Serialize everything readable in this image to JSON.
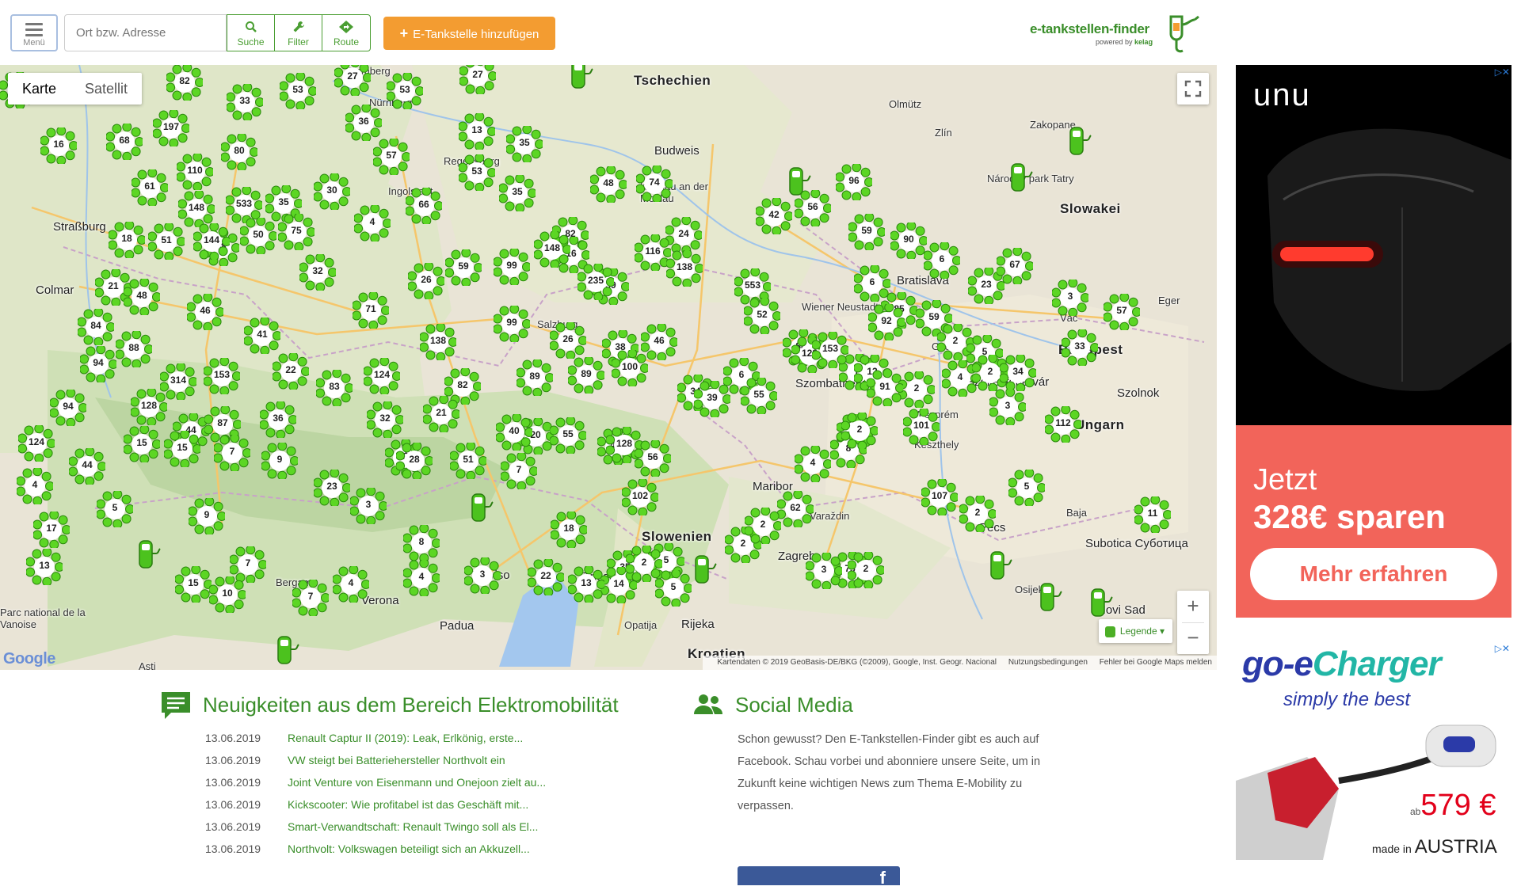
{
  "header": {
    "menu_label": "Menü",
    "search_placeholder": "Ort bzw. Adresse",
    "tools": [
      {
        "label": "Suche",
        "icon": "search-icon"
      },
      {
        "label": "Filter",
        "icon": "wrench-icon"
      },
      {
        "label": "Route",
        "icon": "route-icon"
      }
    ],
    "add_button": "E-Tankstelle hinzufügen",
    "logo_title": "e-tankstellen-finder",
    "logo_powered": "powered by",
    "logo_brand": "kelag"
  },
  "map": {
    "type_options": [
      "Karte",
      "Satellit"
    ],
    "selected_type": "Karte",
    "legend_label": "Legende",
    "attribution": "Kartendaten © 2019 GeoBasis-DE/BKG (©2009), Google, Inst. Geogr. Nacional",
    "terms": "Nutzungsbedingungen",
    "report": "Fehler bei Google Maps melden",
    "google_label": "Google",
    "place_labels": [
      {
        "t": "Tschechien",
        "c": "big"
      },
      {
        "t": "Budweis",
        "c": "mid"
      },
      {
        "t": "Krumau an der Moldau",
        "c": ""
      },
      {
        "t": "Olmütz",
        "c": ""
      },
      {
        "t": "Zlín",
        "c": ""
      },
      {
        "t": "Zakopane",
        "c": ""
      },
      {
        "t": "Národný park Tatry",
        "c": ""
      },
      {
        "t": "Slowakei",
        "c": "big"
      },
      {
        "t": "Bratislava",
        "c": "mid"
      },
      {
        "t": "Straßburg",
        "c": "mid"
      },
      {
        "t": "Colmar",
        "c": "mid"
      },
      {
        "t": "Ingolstadt",
        "c": ""
      },
      {
        "t": "Ungarn",
        "c": "big"
      },
      {
        "t": "Győr",
        "c": ""
      },
      {
        "t": "Székesfehérvár",
        "c": "mid"
      },
      {
        "t": "Veszprém",
        "c": ""
      },
      {
        "t": "Szolnok",
        "c": "mid"
      },
      {
        "t": "Eger",
        "c": ""
      },
      {
        "t": "Vác",
        "c": ""
      },
      {
        "t": "Budapest",
        "c": "big"
      },
      {
        "t": "Szombathely",
        "c": "mid"
      },
      {
        "t": "Maribor",
        "c": "mid"
      },
      {
        "t": "Varaždin",
        "c": ""
      },
      {
        "t": "Zagreb",
        "c": "mid"
      },
      {
        "t": "Slowenien",
        "c": "big"
      },
      {
        "t": "Pécs",
        "c": "mid"
      },
      {
        "t": "Baja",
        "c": ""
      },
      {
        "t": "Subotica Суботица",
        "c": "mid"
      },
      {
        "t": "Osijek",
        "c": ""
      },
      {
        "t": "Novi Sad",
        "c": "mid"
      },
      {
        "t": "Treviso",
        "c": "mid"
      },
      {
        "t": "Verona",
        "c": "mid"
      },
      {
        "t": "Padua",
        "c": "mid"
      },
      {
        "t": "Triest",
        "c": "mid"
      },
      {
        "t": "Rijeka",
        "c": "mid"
      },
      {
        "t": "Opatija",
        "c": ""
      },
      {
        "t": "Kroatien",
        "c": "big"
      },
      {
        "t": "Bergamo",
        "c": ""
      },
      {
        "t": "Parc national de la Vanoise",
        "c": ""
      },
      {
        "t": "Asti",
        "c": ""
      },
      {
        "t": "Salzburg",
        "c": ""
      },
      {
        "t": "Wiener Neustadt",
        "c": ""
      },
      {
        "t": "Keszthely",
        "c": ""
      },
      {
        "t": "Nürnberg",
        "c": ""
      },
      {
        "t": "Regensburg",
        "c": ""
      },
      {
        "t": "Bamberg",
        "c": ""
      }
    ],
    "clusters": [
      "24",
      "16",
      "68",
      "197",
      "82",
      "33",
      "53",
      "27",
      "53",
      "27",
      "13",
      "35",
      "80",
      "110",
      "61",
      "148",
      "533",
      "35",
      "30",
      "57",
      "36",
      "18",
      "51",
      "68",
      "50",
      "75",
      "4",
      "66",
      "53",
      "35",
      "82",
      "16",
      "48",
      "74",
      "39",
      "24",
      "42",
      "56",
      "96",
      "59",
      "90",
      "85",
      "59",
      "2",
      "5",
      "4",
      "2",
      "3",
      "33",
      "57",
      "21",
      "48",
      "144",
      "32",
      "26",
      "59",
      "99",
      "148",
      "235",
      "116",
      "138",
      "553",
      "52",
      "6",
      "6",
      "23",
      "67",
      "84",
      "46",
      "41",
      "71",
      "138",
      "99",
      "26",
      "38",
      "46",
      "88",
      "7",
      "128",
      "12",
      "2",
      "34",
      "112",
      "88",
      "94",
      "153",
      "314",
      "22",
      "124",
      "82",
      "89",
      "89",
      "100",
      "34",
      "6",
      "39",
      "55",
      "153",
      "92",
      "91",
      "3",
      "94",
      "128",
      "44",
      "36",
      "87",
      "83",
      "32",
      "21",
      "20",
      "40",
      "42",
      "102",
      "128",
      "55",
      "56",
      "53",
      "8",
      "4",
      "124",
      "44",
      "15",
      "15",
      "7",
      "9",
      "23",
      "12",
      "28",
      "51",
      "7",
      "2",
      "107",
      "62",
      "101",
      "5",
      "4",
      "5",
      "9",
      "3",
      "8",
      "18",
      "35",
      "5",
      "2",
      "2",
      "75",
      "2",
      "11",
      "17",
      "13",
      "7",
      "15",
      "10",
      "7",
      "4",
      "4",
      "3",
      "22",
      "14",
      "2",
      "13",
      "5",
      "3",
      "2"
    ],
    "singles_count": 11
  },
  "news": {
    "title": "Neuigkeiten aus dem Bereich Elektromobilität",
    "items": [
      {
        "date": "13.06.2019",
        "text": "Renault Captur II (2019): Leak, Erlkönig, erste..."
      },
      {
        "date": "13.06.2019",
        "text": "VW steigt bei Batteriehersteller Northvolt ein"
      },
      {
        "date": "13.06.2019",
        "text": "Joint Venture von Eisenmann und Onejoon zielt au..."
      },
      {
        "date": "13.06.2019",
        "text": "Kickscooter: Wie profitabel ist das Geschäft mit..."
      },
      {
        "date": "13.06.2019",
        "text": "Smart-Verwandtschaft: Renault Twingo soll als El..."
      },
      {
        "date": "13.06.2019",
        "text": "Northvolt: Volkswagen beteiligt sich an Akkuzell..."
      }
    ]
  },
  "social": {
    "title": "Social Media",
    "text": "Schon gewusst? Den E-Tankstellen-Finder gibt es auch auf Facebook. Schau vorbei und abonniere unsere Seite, um in Zukunft keine wichtigen News zum Thema E-Mobility zu verpassen.",
    "fb_glyph": "f"
  },
  "ads": {
    "ad1_brand": "unu",
    "ad1_line1": "Jetzt",
    "ad1_line2": "328€ sparen",
    "ad1_cta": "Mehr erfahren",
    "ad2_brand_a": "go-e",
    "ad2_brand_b": "Charger",
    "ad2_tag": "simply the best",
    "ad2_price_prefix": "ab",
    "ad2_price": "579 €",
    "ad2_made_a": "made in",
    "ad2_made_b": "AUSTRIA"
  },
  "colors": {
    "accent_green": "#3a8e2a",
    "cluster_green": "#3ea214",
    "add_orange": "#f39c31",
    "ad_coral": "#f2645a"
  }
}
